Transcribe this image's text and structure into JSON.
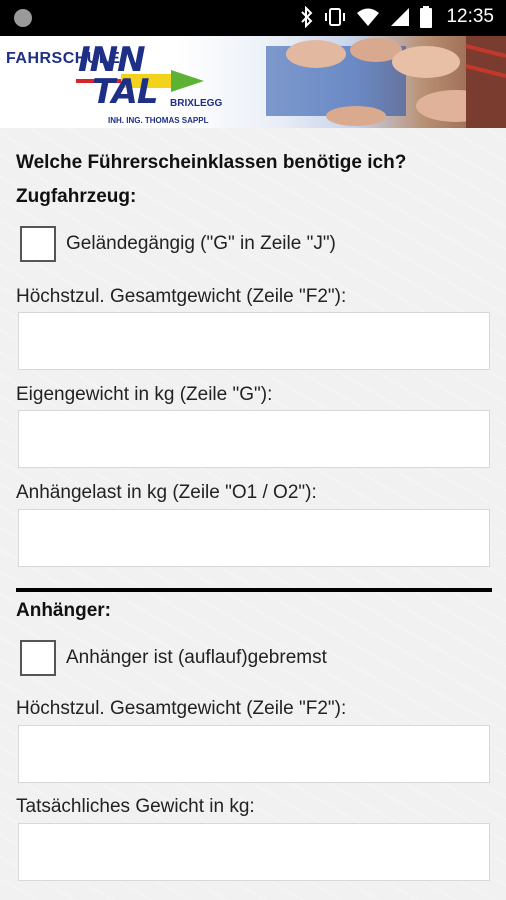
{
  "status_bar": {
    "time": "12:35",
    "icons": [
      "bluetooth-icon",
      "vibrate-icon",
      "wifi-icon",
      "signal-icon",
      "battery-icon"
    ]
  },
  "banner": {
    "brand_small": "FAHRSCHULE",
    "brand_line1": "INN",
    "brand_line2": "TAL",
    "brand_location": "BRIXLEGG",
    "brand_owner": "INH. ING. THOMAS SAPPL"
  },
  "form": {
    "title": "Welche Führerscheinklassen benötige ich?",
    "towing_vehicle": {
      "heading": "Zugfahrzeug:",
      "offroad_label": "Geländegängig (\"G\" in Zeile \"J\")",
      "offroad_checked": false,
      "max_weight_label": "Höchstzul. Gesamtgewicht (Zeile \"F2\"):",
      "max_weight_value": "",
      "own_weight_label": "Eigengewicht in kg (Zeile \"G\"):",
      "own_weight_value": "",
      "trailer_load_label": "Anhängelast in kg  (Zeile \"O1 / O2\"):",
      "trailer_load_value": ""
    },
    "trailer": {
      "heading": "Anhänger:",
      "braked_label": "Anhänger ist (auflauf)gebremst",
      "braked_checked": false,
      "max_weight_label": "Höchstzul. Gesamtgewicht (Zeile \"F2\"):",
      "max_weight_value": "",
      "actual_weight_label": "Tatsächliches Gewicht in kg:",
      "actual_weight_value": ""
    }
  },
  "colors": {
    "brand_blue": "#1e2f86",
    "brand_red": "#d9252a",
    "brand_yellow": "#f2d21b",
    "brand_green": "#5cb234"
  }
}
